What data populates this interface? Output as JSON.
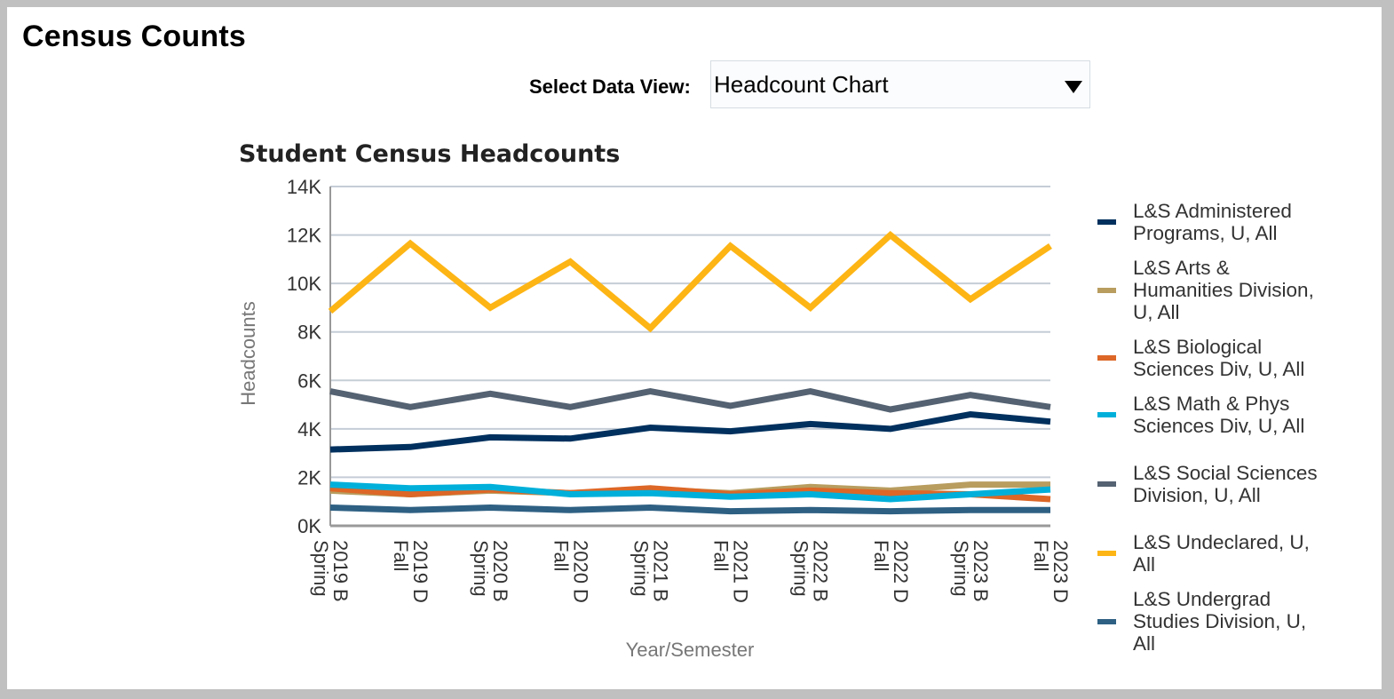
{
  "page": {
    "title": "Census Counts"
  },
  "data_view": {
    "label": "Select Data View:",
    "selected": "Headcount Chart"
  },
  "chart_data": {
    "type": "line",
    "title": "Student Census Headcounts",
    "xlabel": "Year/Semester",
    "ylabel": "Headcounts",
    "ylim": [
      0,
      14000
    ],
    "yticks": [
      0,
      2000,
      4000,
      6000,
      8000,
      10000,
      12000,
      14000
    ],
    "ytick_labels": [
      "0K",
      "2K",
      "4K",
      "6K",
      "8K",
      "10K",
      "12K",
      "14K"
    ],
    "grid": true,
    "legend_position": "right",
    "categories": [
      {
        "line1": "2019 B",
        "line2": "Spring"
      },
      {
        "line1": "2019 D",
        "line2": "Fall"
      },
      {
        "line1": "2020 B",
        "line2": "Spring"
      },
      {
        "line1": "2020 D",
        "line2": "Fall"
      },
      {
        "line1": "2021 B",
        "line2": "Spring"
      },
      {
        "line1": "2021 D",
        "line2": "Fall"
      },
      {
        "line1": "2022 B",
        "line2": "Spring"
      },
      {
        "line1": "2022 D",
        "line2": "Fall"
      },
      {
        "line1": "2023 B",
        "line2": "Spring"
      },
      {
        "line1": "2023 D",
        "line2": "Fall"
      }
    ],
    "series": [
      {
        "name": "L&S Administered Programs, U, All",
        "color": "#00305e",
        "values": [
          3150,
          3250,
          3650,
          3600,
          4050,
          3900,
          4200,
          4000,
          4600,
          4300
        ]
      },
      {
        "name": "L&S Arts & Humanities Division, U, All",
        "color": "#b89d5f",
        "values": [
          1450,
          1300,
          1450,
          1350,
          1500,
          1350,
          1600,
          1450,
          1700,
          1700
        ]
      },
      {
        "name": "L&S Biological Sciences Div, U, All",
        "color": "#dc6727",
        "values": [
          1550,
          1300,
          1500,
          1350,
          1550,
          1300,
          1450,
          1350,
          1300,
          1100
        ]
      },
      {
        "name": "L&S Math & Phys Sciences Div, U, All",
        "color": "#00b0da",
        "values": [
          1700,
          1550,
          1600,
          1300,
          1350,
          1200,
          1300,
          1100,
          1300,
          1500
        ]
      },
      {
        "name": "L&S Social Sciences Division, U, All",
        "color": "#546272",
        "values": [
          5550,
          4900,
          5450,
          4900,
          5550,
          4950,
          5550,
          4800,
          5400,
          4900
        ]
      },
      {
        "name": "L&S Undeclared, U, All",
        "color": "#fdb515",
        "values": [
          8850,
          11650,
          9000,
          10900,
          8150,
          11550,
          9000,
          12000,
          9350,
          11550
        ]
      },
      {
        "name": "L&S Undergrad Studies Division, U, All",
        "color": "#2e6083",
        "values": [
          750,
          650,
          750,
          650,
          750,
          600,
          650,
          600,
          650,
          650
        ]
      }
    ]
  },
  "legend": {
    "items": [
      {
        "lines": [
          "L&S Administered",
          "Programs, U, All"
        ]
      },
      {
        "lines": [
          "L&S Arts &",
          "Humanities Division,",
          "U, All"
        ]
      },
      {
        "lines": [
          "L&S Biological",
          "Sciences Div, U, All"
        ]
      },
      {
        "lines": [
          "L&S Math & Phys",
          "Sciences Div, U, All"
        ]
      },
      {
        "lines": [
          "L&S Social Sciences",
          "Division, U, All"
        ]
      },
      {
        "lines": [
          "L&S Undeclared, U,",
          "All"
        ]
      },
      {
        "lines": [
          "L&S Undergrad",
          "Studies Division, U,",
          "All"
        ]
      }
    ]
  }
}
